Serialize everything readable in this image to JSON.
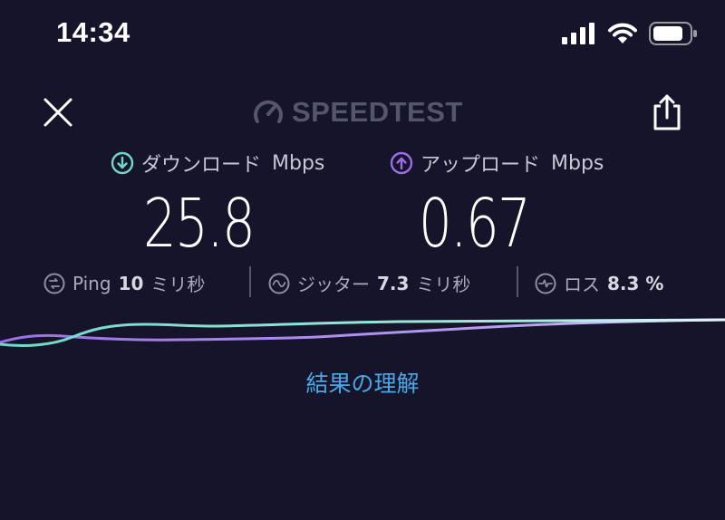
{
  "status_bar": {
    "time": "14:34"
  },
  "header": {
    "brand": "SPEEDTEST"
  },
  "download": {
    "label": "ダウンロード",
    "unit": "Mbps",
    "value": "25.8"
  },
  "upload": {
    "label": "アップロード",
    "unit": "Mbps",
    "value": "0.67"
  },
  "stats": {
    "ping": {
      "label": "Ping",
      "value": "10",
      "unit": "ミリ秒"
    },
    "jitter": {
      "label": "ジッター",
      "value": "7.3",
      "unit": "ミリ秒"
    },
    "loss": {
      "label": "ロス",
      "value": "8.3 %"
    }
  },
  "link": {
    "understand": "結果の理解"
  },
  "colors": {
    "background": "#15142a",
    "download": "#6fd9c6",
    "upload": "#9b6ee8",
    "link": "#4aa8e6"
  },
  "icons": [
    "signal-icon",
    "wifi-icon",
    "battery-icon",
    "close-icon",
    "speedometer-icon",
    "share-icon",
    "download-arrow-icon",
    "upload-arrow-icon",
    "ping-icon",
    "jitter-icon",
    "loss-icon"
  ]
}
